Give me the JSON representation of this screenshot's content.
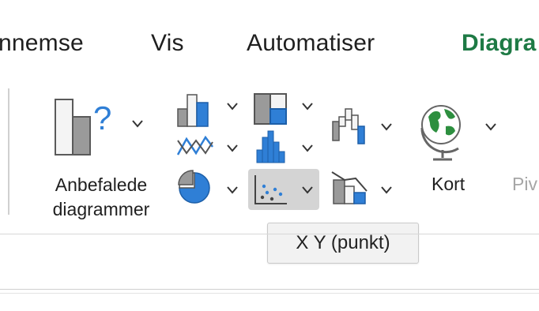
{
  "ribbon": {
    "tabs": [
      {
        "label": "nnemse"
      },
      {
        "label": "Vis"
      },
      {
        "label": "Automatiser"
      },
      {
        "label": "Diagra"
      }
    ],
    "recommended_label": "Anbefalede\ndiagrammer",
    "map_label": "Kort",
    "pivot_label_partial": "Piv",
    "accent_color": "#1e7a45",
    "chart_blue": "#2f7fd6",
    "chart_gray": "#9a9a9a"
  },
  "tooltip": {
    "text": "X Y (punkt)"
  }
}
